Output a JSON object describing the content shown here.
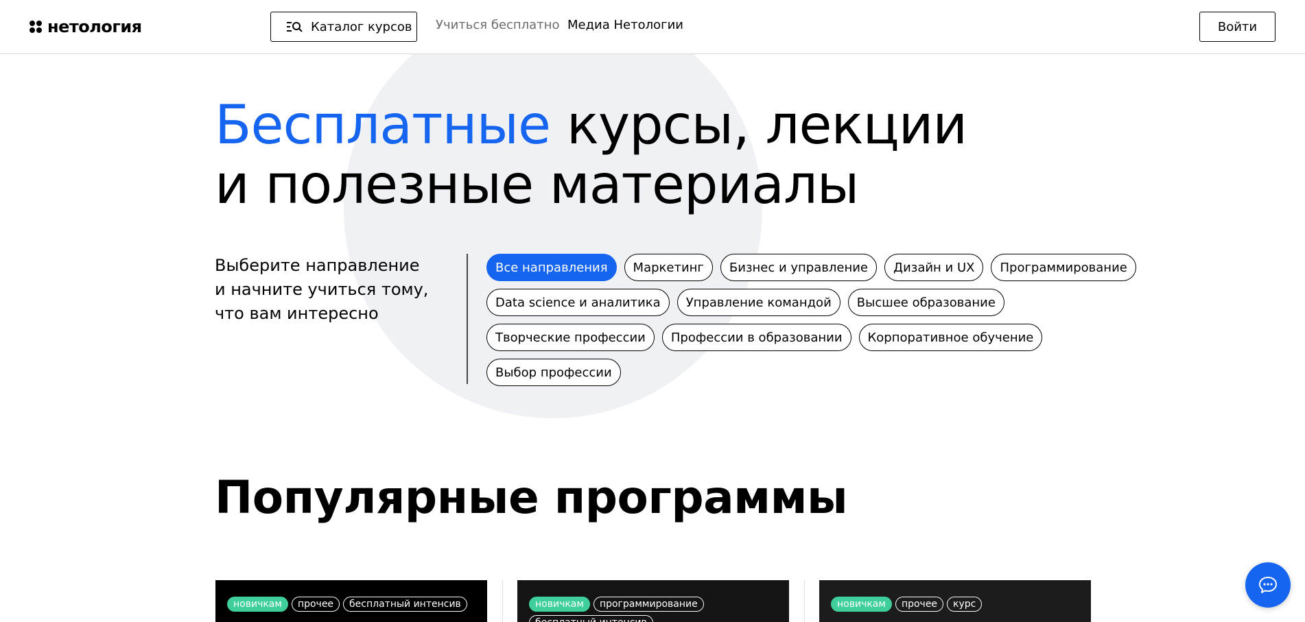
{
  "header": {
    "logo_text": "нетология",
    "catalog_label": "Каталог курсов",
    "nav": {
      "free": "Учиться бесплатно",
      "media": "Медиа Нетологии"
    },
    "login_label": "Войти"
  },
  "hero": {
    "title_accent": "Бесплатные",
    "title_rest": " курсы, лекции",
    "title_line2": "и полезные материалы",
    "intro_line1": "Выберите направление",
    "intro_line2": "и начните учиться тому,",
    "intro_line3": "что вам интересно"
  },
  "directions": [
    [
      "Все направления",
      "Маркетинг",
      "Бизнес и управление",
      "Дизайн и UX",
      "Программирование"
    ],
    [
      "Data science и аналитика",
      "Управление командой",
      "Высшее образование"
    ],
    [
      "Творческие профессии",
      "Профессии в образовании",
      "Корпоративное обучение"
    ],
    [
      "Выбор профессии"
    ]
  ],
  "active_direction": "Все направления",
  "popular": {
    "title": "Популярные программы",
    "cards": [
      {
        "tags": [
          "новичкам",
          "прочее",
          "бесплатный интенсив"
        ]
      },
      {
        "tags": [
          "новичкам",
          "программирование",
          "бесплатный интенсив"
        ]
      },
      {
        "tags": [
          "новичкам",
          "прочее",
          "курс"
        ]
      }
    ]
  },
  "colors": {
    "accent": "#1565f0",
    "tag_green": "#3ecf9a",
    "circle_bg": "#eff1f4"
  },
  "icons": {
    "catalog": "catalog-search-icon",
    "chat": "chat-icon",
    "logo": "logo-mark-icon"
  }
}
